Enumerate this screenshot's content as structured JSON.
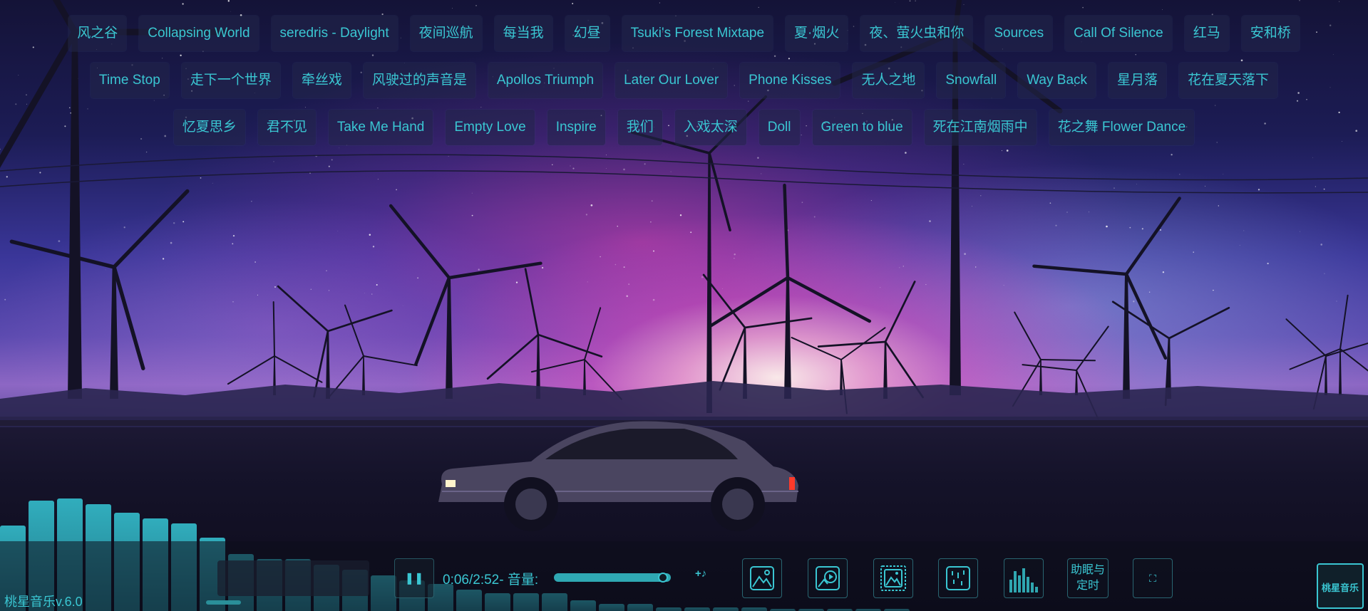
{
  "playlist": {
    "rows": [
      [
        "风之谷",
        "Collapsing World",
        "seredris - Daylight",
        "夜间巡航",
        "每当我",
        "幻昼",
        "Tsuki's Forest Mixtape",
        "夏·烟火",
        "夜、萤火虫和你",
        "Sources",
        "Call Of Silence",
        "红马",
        "安和桥"
      ],
      [
        "Time Stop",
        "走下一个世界",
        "牵丝戏",
        "风驶过的声音是",
        "Apollos Triumph",
        "Later Our Lover",
        "Phone Kisses",
        "无人之地",
        "Snowfall",
        "Way Back",
        "星月落",
        "花在夏天落下"
      ],
      [
        "忆夏思乡",
        "君不见",
        "Take Me Hand",
        "Empty Love",
        "Inspire",
        "我们",
        "入戏太深",
        "Doll",
        "Green to blue",
        "死在江南烟雨中",
        "花之舞 Flower Dance"
      ]
    ]
  },
  "player": {
    "time_display": "0:06/2:52-",
    "volume_label": "音量:",
    "volume_level": 0.93,
    "progress": 0.035,
    "add_label": "+♪",
    "sleep_timer_label_1": "助眠与",
    "sleep_timer_label_2": "定时",
    "fullscreen_label": "⛶"
  },
  "app": {
    "version": "桃星音乐v.6.0",
    "logo_text": "桃星音乐"
  },
  "visualizer": {
    "levels": [
      0.48,
      0.62,
      0.63,
      0.6,
      0.55,
      0.52,
      0.49,
      0.41,
      0.32,
      0.29,
      0.29,
      0.26,
      0.23,
      0.2,
      0.17,
      0.15,
      0.12,
      0.1,
      0.1,
      0.1,
      0.06,
      0.04,
      0.04,
      0.02,
      0.02,
      0.02,
      0.02,
      0.01,
      0.01,
      0.01,
      0.01,
      0.01
    ],
    "color": "#34bcc8"
  },
  "icons": [
    "pause-icon",
    "image-icon",
    "video-image-icon",
    "frame-image-icon",
    "rain-icon",
    "equalizer-icon",
    "fullscreen-icon"
  ]
}
